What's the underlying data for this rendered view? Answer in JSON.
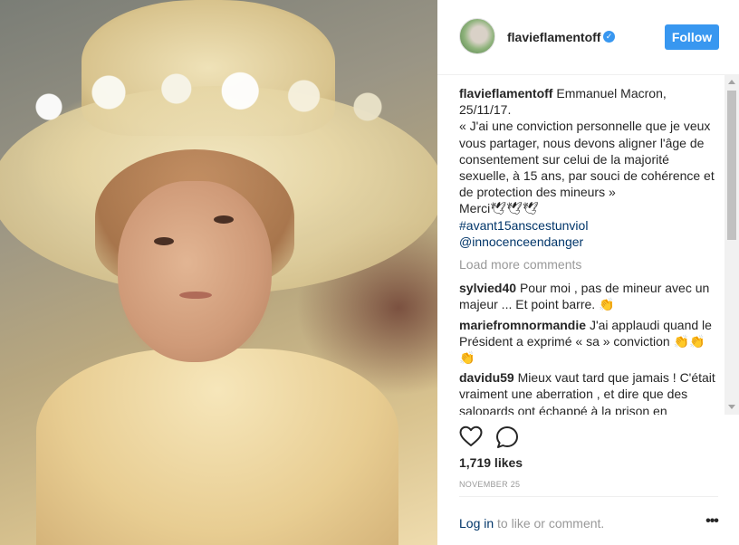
{
  "post": {
    "username": "flavieflamentoff",
    "follow_label": "Follow",
    "caption": {
      "lines": [
        "Emmanuel Macron,",
        "25/11/17.",
        "« J'ai une conviction personnelle que je veux",
        "vous partager, nous devons aligner l'âge de",
        "consentement sur celui de la majorité",
        "sexuelle, à 15 ans, par souci de cohérence et",
        "de protection des mineurs »",
        "Merci🕊🕊🕊"
      ],
      "hashtag": "#avant15anscestunviol",
      "mention": "@innocenceendanger"
    },
    "load_more": "Load more comments",
    "comments": [
      {
        "user": "sylvied40",
        "text": "Pour moi , pas de mineur avec un majeur ... Et point barre. 👏"
      },
      {
        "user": "mariefromnormandie",
        "text": "J'ai applaudi quand le Président a exprimé « sa » conviction 👏👏👏"
      },
      {
        "user": "davidu59",
        "text": "Mieux vaut tard que jamais ! C'était vraiment une aberration , et dire que des salopards ont échappé à la prison en"
      }
    ],
    "likes": "1,719 likes",
    "date": "NOVEMBER 25",
    "login_link": "Log in",
    "login_rest": " to like or comment.",
    "more_label": "•••"
  },
  "icons": {
    "verified": "verified-badge-icon",
    "like": "heart-icon",
    "comment": "speech-bubble-icon",
    "more": "more-options-icon"
  },
  "colors": {
    "accent": "#3897f0",
    "link": "#003569",
    "muted": "#999999",
    "text": "#262626"
  }
}
